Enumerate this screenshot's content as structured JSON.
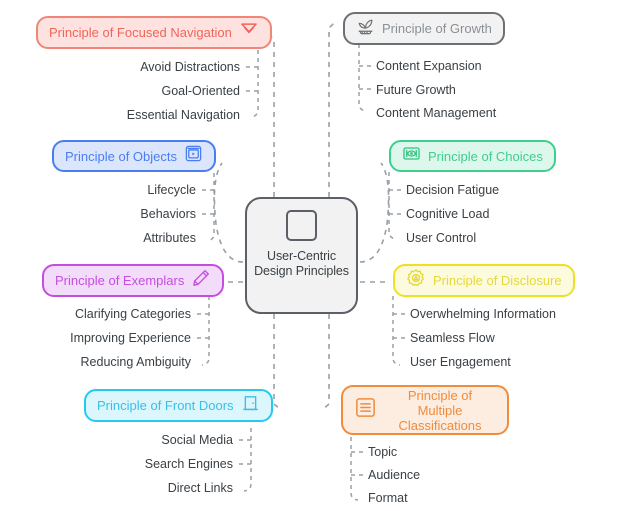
{
  "diagram": {
    "type": "mind-map",
    "center": {
      "label": "User-Centric Design Principles",
      "icon": "rounded-square-icon",
      "border_color": "#5b6066",
      "fill_color": "#f2f2f2",
      "text_color": "#3a4045"
    },
    "connector_style": "dashed",
    "connector_color": "#9aa0a6",
    "branches": [
      {
        "id": "focused-navigation",
        "label": "Principle of Focused Navigation",
        "icon": "double-chevron-down-icon",
        "icon_position": "right",
        "color": "#f08578",
        "fill": "#fde2e0",
        "text_color": "#f0655a",
        "side": "left",
        "leaves": [
          "Avoid Distractions",
          "Goal-Oriented",
          "Essential Navigation"
        ]
      },
      {
        "id": "growth",
        "label": "Principle of Growth",
        "icon": "seedling-icon",
        "icon_position": "left",
        "color": "#6b7075",
        "fill": "#f2f2f2",
        "text_color": "#8b9096",
        "side": "right",
        "leaves": [
          "Content Expansion",
          "Future Growth",
          "Content Management"
        ]
      },
      {
        "id": "objects",
        "label": "Principle of Objects",
        "icon": "boxed-play-icon",
        "icon_position": "right",
        "color": "#4a7ef0",
        "fill": "#dbe6fd",
        "text_color": "#4a7ef0",
        "side": "left",
        "leaves": [
          "Lifecycle",
          "Behaviors",
          "Attributes"
        ]
      },
      {
        "id": "choices",
        "label": "Principle of Choices",
        "icon": "framed-eye-icon",
        "icon_position": "left",
        "color": "#3ecf8e",
        "fill": "#ddf7ec",
        "text_color": "#3ecf8e",
        "side": "right",
        "leaves": [
          "Decision Fatigue",
          "Cognitive Load",
          "User Control"
        ]
      },
      {
        "id": "exemplars",
        "label": "Principle of Exemplars",
        "icon": "pencil-icon",
        "icon_position": "right",
        "color": "#c44ee0",
        "fill": "#f3dbfa",
        "text_color": "#c44ee0",
        "side": "left",
        "leaves": [
          "Clarifying Categories",
          "Improving Experience",
          "Reducing Ambiguity"
        ]
      },
      {
        "id": "disclosure",
        "label": "Principle of Disclosure",
        "icon": "gear-icon",
        "icon_position": "left",
        "color": "#ece123",
        "fill": "#fdfbdd",
        "text_color": "#e6d83c",
        "side": "right",
        "leaves": [
          "Overwhelming Information",
          "Seamless Flow",
          "User Engagement"
        ]
      },
      {
        "id": "front-doors",
        "label": "Principle of Front Doors",
        "icon": "door-icon",
        "icon_position": "right",
        "color": "#25c9f0",
        "fill": "#dcf6fd",
        "text_color": "#39bfe8",
        "side": "left",
        "leaves": [
          "Social Media",
          "Search Engines",
          "Direct Links"
        ]
      },
      {
        "id": "multiple-classifications",
        "label": "Principle of Multiple Classifications",
        "icon": "list-box-icon",
        "icon_position": "left",
        "color": "#ef8c3e",
        "fill": "#fdece0",
        "text_color": "#ef8c3e",
        "side": "right",
        "leaves": [
          "Topic",
          "Audience",
          "Format"
        ]
      }
    ]
  }
}
